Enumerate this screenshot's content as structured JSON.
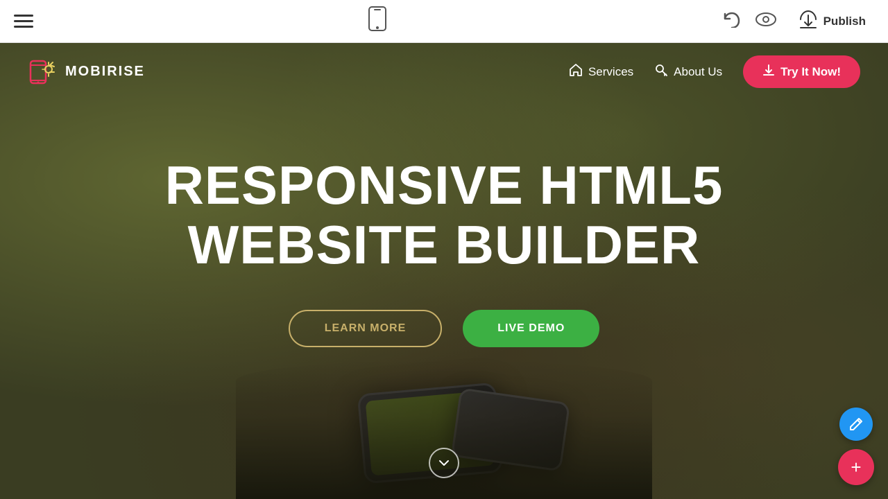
{
  "toolbar": {
    "publish_label": "Publish"
  },
  "hero": {
    "logo": {
      "text": "MOBIRISE"
    },
    "nav": {
      "services_label": "Services",
      "about_label": "About Us",
      "try_label": "Try It Now!"
    },
    "title_line1": "RESPONSIVE HTML5",
    "title_line2": "WEBSITE BUILDER",
    "btn_learn": "LEARN MORE",
    "btn_demo": "LIVE DEMO"
  },
  "fab": {
    "edit_icon": "✏",
    "add_icon": "+"
  }
}
